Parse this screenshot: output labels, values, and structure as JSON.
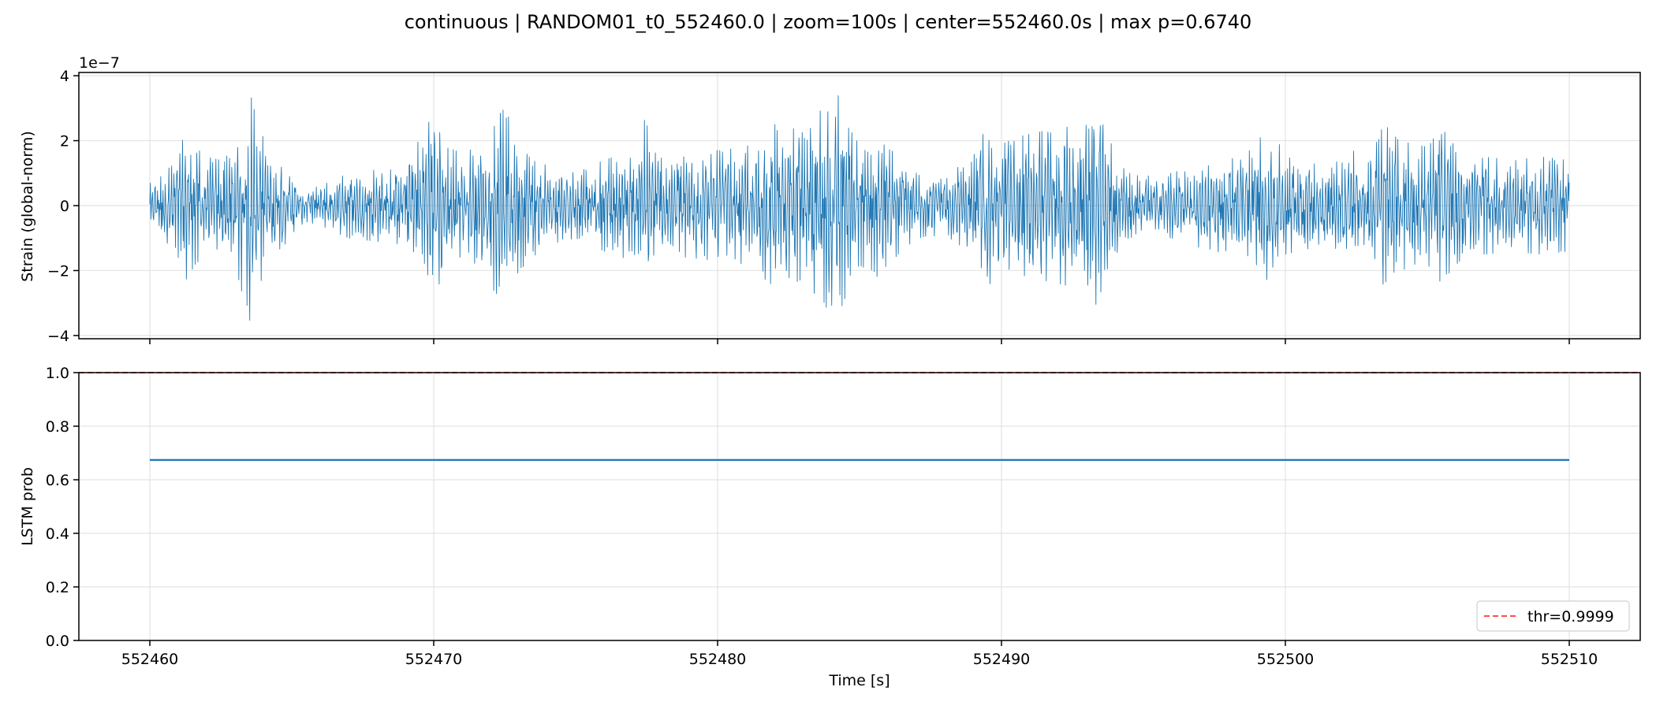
{
  "title": "continuous | RANDOM01_t0_552460.0 | zoom=100s | center=552460.0s | max p=0.6740",
  "colors": {
    "series": "#1f77b4",
    "threshold": "#ff4d4d",
    "grid": "#e3e3e3"
  },
  "chart_data": [
    {
      "type": "line",
      "title": "",
      "ylabel": "Strain (global-norm)",
      "y_scale_label": "1e−7",
      "x": {
        "start": 552460,
        "end": 552510
      },
      "xlim": [
        552457.5,
        552512.5
      ],
      "ylim": [
        -4.1,
        4.1
      ],
      "yticks": [
        -4,
        -2,
        0,
        2,
        4
      ],
      "ytick_labels": [
        "−4",
        "−2",
        "0",
        "2",
        "4"
      ],
      "grid": true,
      "envelope": [
        [
          552460.0,
          0.7
        ],
        [
          552460.3,
          0.8
        ],
        [
          552461.0,
          1.6
        ],
        [
          552461.3,
          2.4
        ],
        [
          552461.6,
          1.8
        ],
        [
          552462.0,
          1.5
        ],
        [
          552462.5,
          1.4
        ],
        [
          552463.0,
          1.8
        ],
        [
          552463.5,
          3.6
        ],
        [
          552463.8,
          2.5
        ],
        [
          552464.5,
          1.4
        ],
        [
          552465.0,
          1.0
        ],
        [
          552465.5,
          0.5
        ],
        [
          552466.0,
          0.6
        ],
        [
          552467.0,
          1.0
        ],
        [
          552468.0,
          1.1
        ],
        [
          552469.0,
          1.2
        ],
        [
          552469.7,
          2.4
        ],
        [
          552470.0,
          2.8
        ],
        [
          552470.5,
          1.8
        ],
        [
          552471.0,
          1.6
        ],
        [
          552471.5,
          1.8
        ],
        [
          552472.0,
          2.5
        ],
        [
          552472.5,
          3.0
        ],
        [
          552473.0,
          2.0
        ],
        [
          552474.0,
          1.2
        ],
        [
          552475.0,
          1.0
        ],
        [
          552476.0,
          1.4
        ],
        [
          552477.0,
          1.7
        ],
        [
          552477.5,
          2.8
        ],
        [
          552478.0,
          1.5
        ],
        [
          552479.0,
          1.6
        ],
        [
          552480.0,
          1.7
        ],
        [
          552481.0,
          1.8
        ],
        [
          552482.0,
          2.5
        ],
        [
          552482.5,
          2.4
        ],
        [
          552483.0,
          2.3
        ],
        [
          552483.5,
          2.8
        ],
        [
          552484.2,
          3.5
        ],
        [
          552484.6,
          2.6
        ],
        [
          552485.0,
          1.8
        ],
        [
          552485.5,
          2.3
        ],
        [
          552486.0,
          1.8
        ],
        [
          552487.0,
          1.0
        ],
        [
          552488.0,
          0.9
        ],
        [
          552489.0,
          1.5
        ],
        [
          552489.5,
          2.5
        ],
        [
          552490.0,
          2.0
        ],
        [
          552491.0,
          2.2
        ],
        [
          552492.0,
          2.4
        ],
        [
          552493.0,
          2.6
        ],
        [
          552493.3,
          3.1
        ],
        [
          552493.8,
          2.0
        ],
        [
          552494.5,
          1.0
        ],
        [
          552495.0,
          0.9
        ],
        [
          552496.0,
          1.0
        ],
        [
          552497.0,
          1.3
        ],
        [
          552498.0,
          1.5
        ],
        [
          552499.0,
          2.0
        ],
        [
          552499.5,
          2.4
        ],
        [
          552500.0,
          1.5
        ],
        [
          552501.0,
          1.3
        ],
        [
          552501.5,
          1.0
        ],
        [
          552502.0,
          1.6
        ],
        [
          552503.0,
          1.8
        ],
        [
          552503.5,
          2.5
        ],
        [
          552504.0,
          2.0
        ],
        [
          552505.0,
          1.8
        ],
        [
          552505.5,
          2.4
        ],
        [
          552506.0,
          1.8
        ],
        [
          552507.0,
          1.5
        ],
        [
          552508.0,
          1.4
        ],
        [
          552509.0,
          1.5
        ],
        [
          552510.0,
          1.4
        ]
      ]
    },
    {
      "type": "line",
      "title": "",
      "xlabel": "Time [s]",
      "ylabel": "LSTM prob",
      "xlim": [
        552457.5,
        552512.5
      ],
      "ylim": [
        0.0,
        1.0
      ],
      "xticks": [
        552460,
        552470,
        552480,
        552490,
        552500,
        552510
      ],
      "xtick_labels": [
        "552460",
        "552470",
        "552480",
        "552490",
        "552500",
        "552510"
      ],
      "yticks": [
        0.0,
        0.2,
        0.4,
        0.6,
        0.8,
        1.0
      ],
      "ytick_labels": [
        "0.0",
        "0.2",
        "0.4",
        "0.6",
        "0.8",
        "1.0"
      ],
      "grid": true,
      "series": [
        {
          "x": [
            552460,
            552510
          ],
          "values": [
            0.674,
            0.674
          ]
        }
      ],
      "threshold": {
        "value": 0.9999,
        "label": "thr=0.9999",
        "style": "dashed"
      },
      "legend_position": "lower-right"
    }
  ]
}
